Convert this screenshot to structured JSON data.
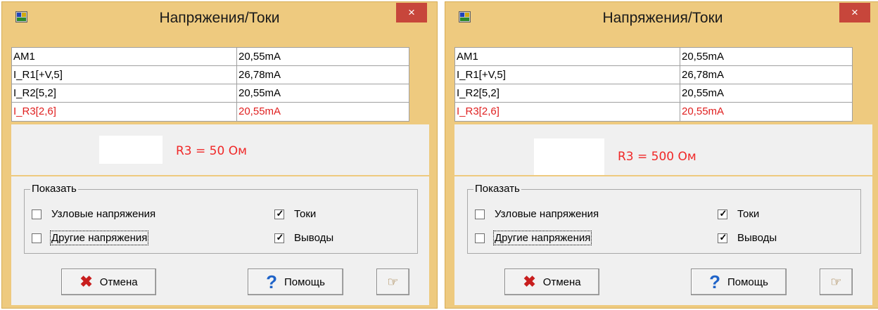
{
  "dialogs": [
    {
      "title": "Напряжения/Токи",
      "close_icon": "×",
      "rows": [
        {
          "name": "AM1",
          "value": "20,55mA"
        },
        {
          "name": "I_R1[+V,5]",
          "value": "26,78mA"
        },
        {
          "name": "I_R2[5,2]",
          "value": "20,55mA"
        },
        {
          "name": "I_R3[2,6]",
          "value": "20,55mA"
        }
      ],
      "r3_label": "R3 = 50 Ом",
      "group_title": "Показать",
      "options": {
        "node_voltages": {
          "label": "Узловые напряжения",
          "checked": false
        },
        "other_voltages": {
          "label": "Другие напряжения",
          "checked": false
        },
        "currents": {
          "label": "Токи",
          "checked": true
        },
        "terminals": {
          "label": "Выводы",
          "checked": true
        }
      },
      "cancel_label": "Отмена",
      "help_label": "Помощь"
    },
    {
      "title": "Напряжения/Токи",
      "close_icon": "×",
      "rows": [
        {
          "name": "AM1",
          "value": "20,55mA"
        },
        {
          "name": "I_R1[+V,5]",
          "value": "26,78mA"
        },
        {
          "name": "I_R2[5,2]",
          "value": "20,55mA"
        },
        {
          "name": "I_R3[2,6]",
          "value": "20,55mA"
        }
      ],
      "r3_label": "R3 = 500 Ом",
      "group_title": "Показать",
      "options": {
        "node_voltages": {
          "label": "Узловые напряжения",
          "checked": false
        },
        "other_voltages": {
          "label": "Другие напряжения",
          "checked": false
        },
        "currents": {
          "label": "Токи",
          "checked": true
        },
        "terminals": {
          "label": "Выводы",
          "checked": true
        }
      },
      "cancel_label": "Отмена",
      "help_label": "Помощь"
    }
  ],
  "icons": {
    "cancel": "✖",
    "help": "?",
    "hand": "☞",
    "check": "✓",
    "app": "app-icon"
  },
  "colors": {
    "frame": "#eeca7f",
    "close_button": "#c7463b",
    "highlight_text": "#e02020",
    "r3_label": "#f02828"
  }
}
